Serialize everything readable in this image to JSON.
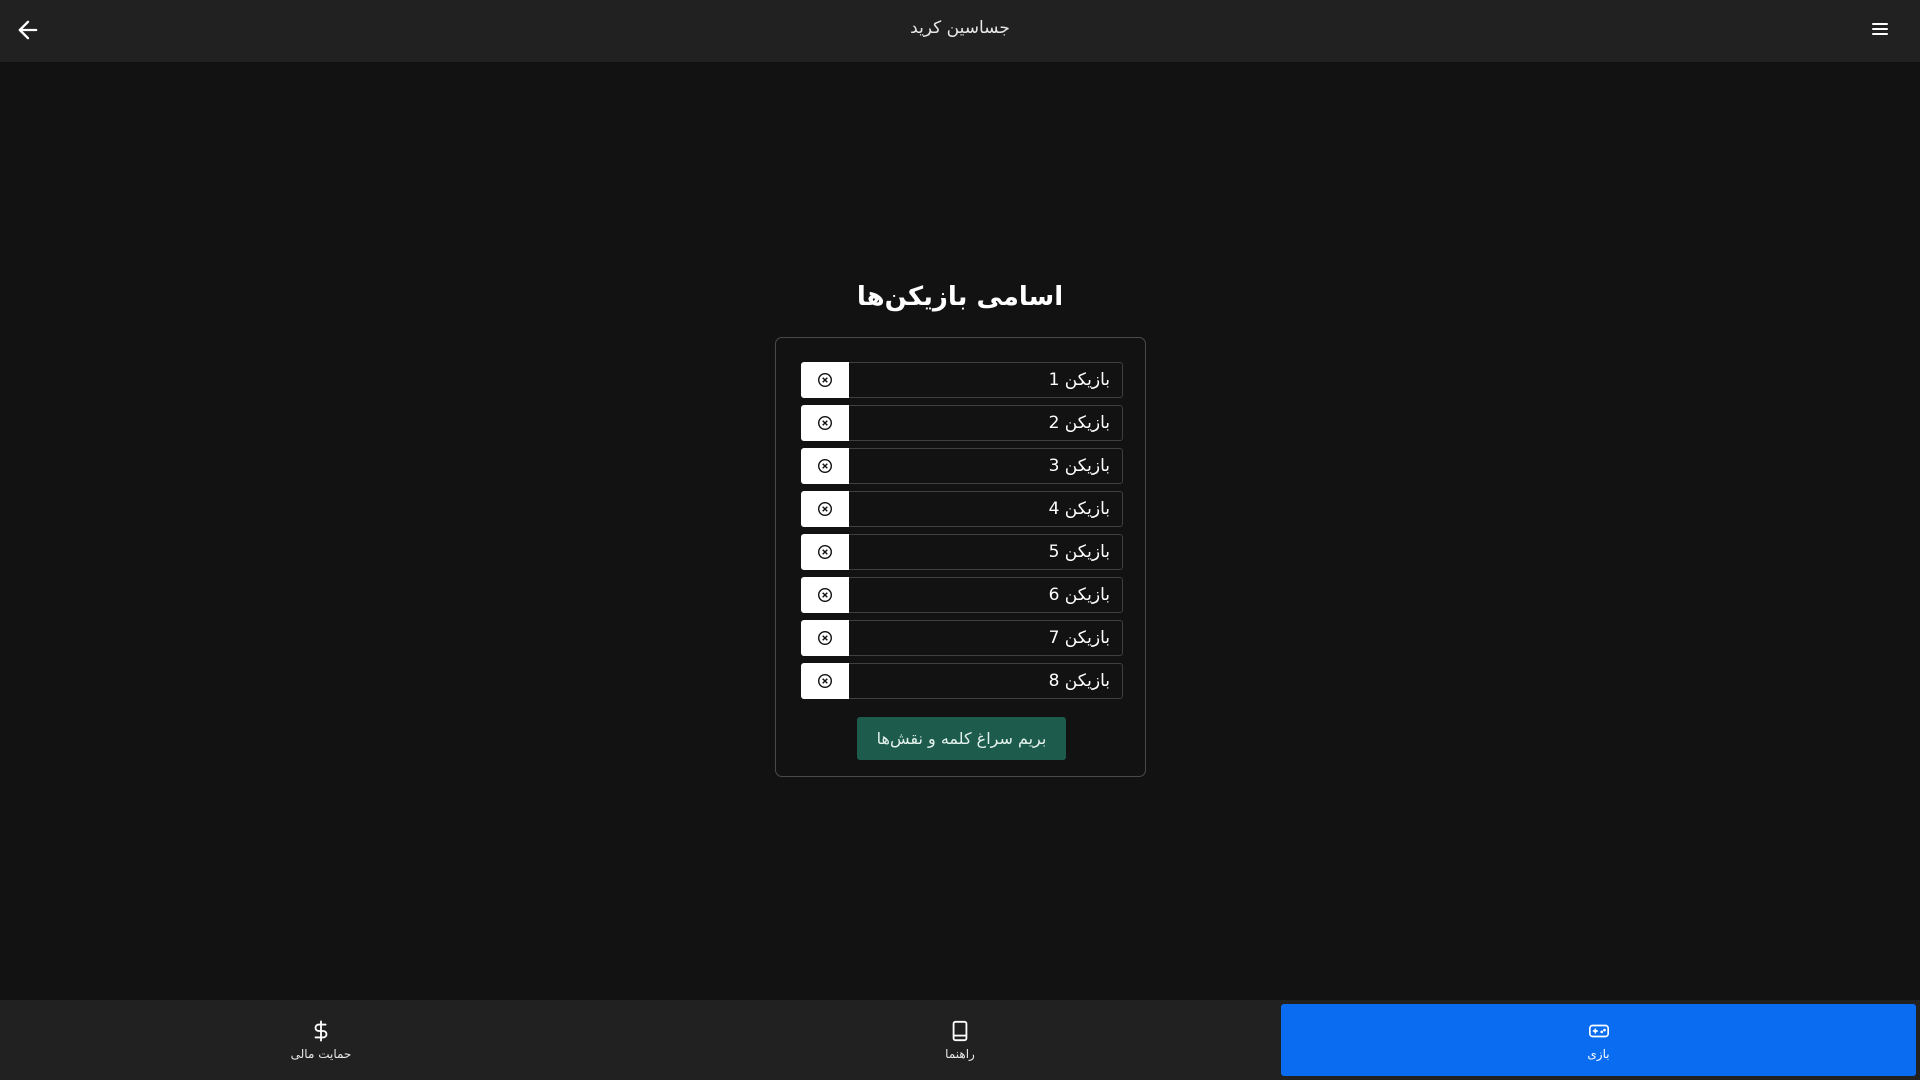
{
  "header": {
    "title": "جساسین کرید",
    "back_icon": "arrow-left-icon",
    "menu_icon": "hamburger-menu-icon"
  },
  "main": {
    "heading": "اسامی بازیکن‌ها",
    "players": [
      {
        "name": "بازیکن 1"
      },
      {
        "name": "بازیکن 2"
      },
      {
        "name": "بازیکن 3"
      },
      {
        "name": "بازیکن 4"
      },
      {
        "name": "بازیکن 5"
      },
      {
        "name": "بازیکن 6"
      },
      {
        "name": "بازیکن 7"
      },
      {
        "name": "بازیکن 8"
      }
    ],
    "remove_icon": "circle-x-icon",
    "submit_label": "بریم سراغ کلمه و نقش‌ها",
    "submit_color": "#1d5c4c"
  },
  "bottom_nav": {
    "active_color": "#0a6cf0",
    "items": [
      {
        "label": "حمایت مالی",
        "icon": "dollar-icon"
      },
      {
        "label": "راهنما",
        "icon": "book-icon"
      },
      {
        "label": "بازی",
        "icon": "gamepad-icon",
        "active": true
      }
    ]
  }
}
